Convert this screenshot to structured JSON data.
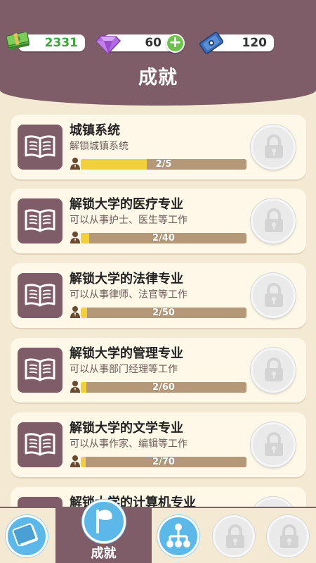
{
  "header": {
    "money": "2331",
    "gems": "60",
    "tickets": "120",
    "title": "成就"
  },
  "achievements": [
    {
      "title": "城镇系统",
      "desc": "解锁城镇系统",
      "progress": "2/5",
      "fraction": 0.4
    },
    {
      "title": "解锁大学的医疗专业",
      "desc": "可以从事护士、医生等工作",
      "progress": "2/40",
      "fraction": 0.05
    },
    {
      "title": "解锁大学的法律专业",
      "desc": "可以从事律师、法官等工作",
      "progress": "2/50",
      "fraction": 0.04
    },
    {
      "title": "解锁大学的管理专业",
      "desc": "可以从事部门经理等工作",
      "progress": "2/60",
      "fraction": 0.033
    },
    {
      "title": "解锁大学的文学专业",
      "desc": "可以从事作家、编辑等工作",
      "progress": "2/70",
      "fraction": 0.029
    },
    {
      "title": "解锁大学的计算机专业",
      "desc": "",
      "progress": "",
      "fraction": 0
    }
  ],
  "nav": {
    "active_label": "成就"
  },
  "colors": {
    "primary": "#7e5d69",
    "background": "#f4ead4",
    "progress_fill": "#f2cf3c",
    "progress_track": "#b49878"
  }
}
